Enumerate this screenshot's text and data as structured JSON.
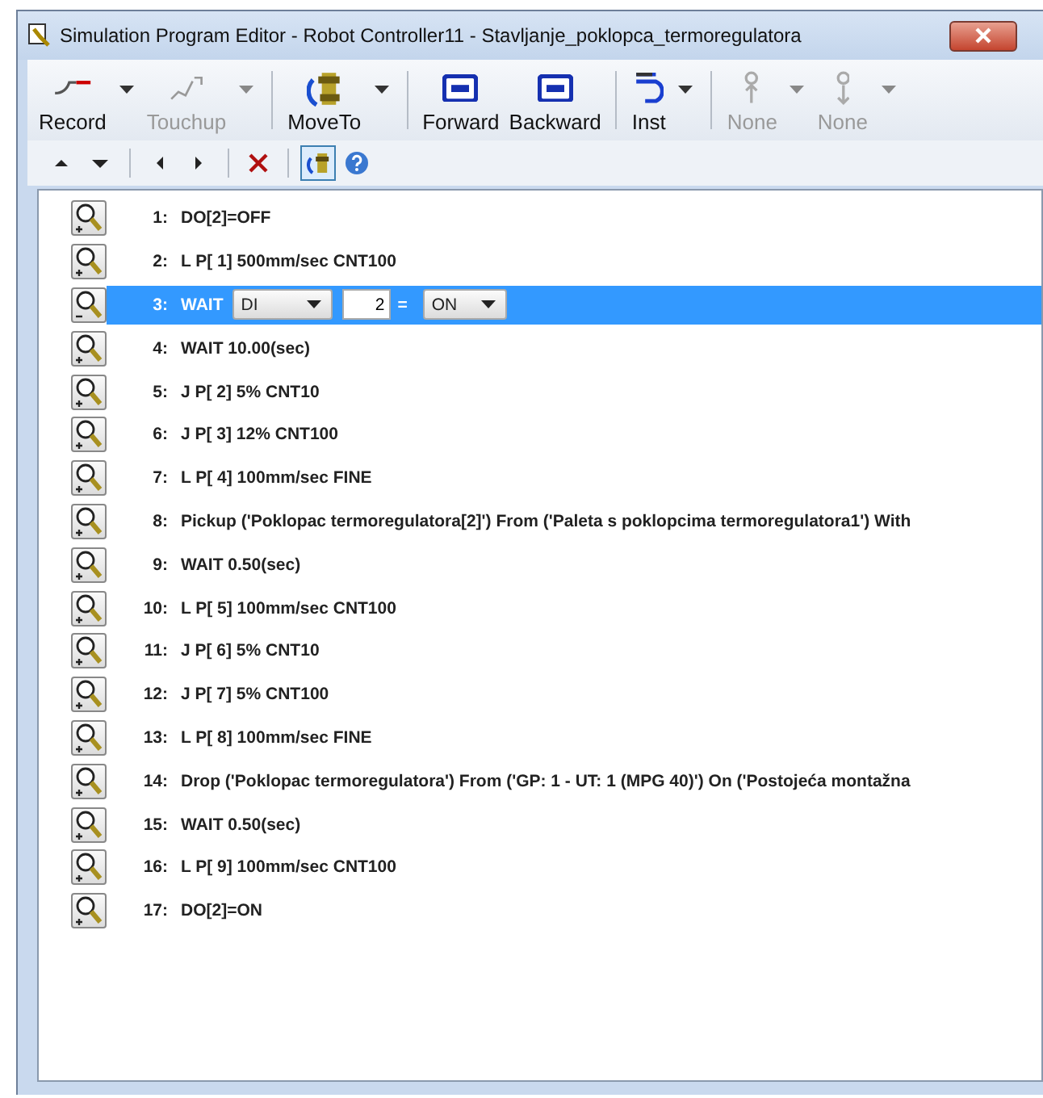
{
  "window": {
    "title": "Simulation Program Editor - Robot Controller11 - Stavljanje_poklopca_termoregulatora"
  },
  "toolbar": [
    {
      "kind": "record",
      "label": "Record",
      "disabled": false,
      "dropdown": true
    },
    {
      "kind": "touchup",
      "label": "Touchup",
      "disabled": true,
      "dropdown": true
    },
    {
      "kind": "moveto",
      "label": "MoveTo",
      "disabled": false,
      "dropdown": true
    },
    {
      "kind": "forward",
      "label": "Forward",
      "disabled": false,
      "dropdown": false
    },
    {
      "kind": "backward",
      "label": "Backward",
      "disabled": false,
      "dropdown": false
    },
    {
      "kind": "inst",
      "label": "Inst",
      "disabled": false,
      "dropdown": true
    },
    {
      "kind": "none-up",
      "label": "None",
      "disabled": true,
      "dropdown": true
    },
    {
      "kind": "none-down",
      "label": "None",
      "disabled": true,
      "dropdown": true
    }
  ],
  "secondary_toolbar": [
    {
      "kind": "up",
      "selected": false
    },
    {
      "kind": "down",
      "selected": false
    },
    {
      "kind": "left",
      "selected": false
    },
    {
      "kind": "right",
      "selected": false
    },
    {
      "kind": "delete",
      "selected": false
    },
    {
      "kind": "robot",
      "selected": true
    },
    {
      "kind": "help",
      "selected": false
    }
  ],
  "program_lines": [
    {
      "number": "1:",
      "text": "DO[2]=OFF",
      "selected": false,
      "expanded": false
    },
    {
      "number": "2:",
      "text": "L P[ 1] 500mm/sec  CNT100",
      "selected": false,
      "expanded": false
    },
    {
      "number": "3:",
      "kind": "edit",
      "keyword": "WAIT",
      "signal": "DI",
      "index": "2",
      "operator": "=",
      "state": "ON",
      "selected": true,
      "expanded": true
    },
    {
      "number": "4:",
      "text": "WAIT 10.00(sec)",
      "selected": false,
      "expanded": false
    },
    {
      "number": "5:",
      "text": "J P[ 2] 5%  CNT10",
      "selected": false,
      "expanded": false
    },
    {
      "number": "6:",
      "text": "J P[ 3] 12%  CNT100",
      "selected": false,
      "expanded": false
    },
    {
      "number": "7:",
      "text": "L P[ 4] 100mm/sec  FINE",
      "selected": false,
      "expanded": false
    },
    {
      "number": "8:",
      "text": "Pickup ('Poklopac termoregulatora[2]') From ('Paleta s poklopcima termoregulatora1') With",
      "selected": false,
      "expanded": false
    },
    {
      "number": "9:",
      "text": "WAIT 0.50(sec)",
      "selected": false,
      "expanded": false
    },
    {
      "number": "10:",
      "text": "L P[ 5] 100mm/sec  CNT100",
      "selected": false,
      "expanded": false
    },
    {
      "number": "11:",
      "text": "J P[ 6] 5%  CNT10",
      "selected": false,
      "expanded": false
    },
    {
      "number": "12:",
      "text": "J P[ 7] 5%  CNT100",
      "selected": false,
      "expanded": false
    },
    {
      "number": "13:",
      "text": "L P[ 8] 100mm/sec  FINE",
      "selected": false,
      "expanded": false
    },
    {
      "number": "14:",
      "text": "Drop ('Poklopac termoregulatora') From ('GP: 1 - UT: 1  (MPG 40)') On ('Postojeća montažna",
      "selected": false,
      "expanded": false
    },
    {
      "number": "15:",
      "text": "WAIT 0.50(sec)",
      "selected": false,
      "expanded": false
    },
    {
      "number": "16:",
      "text": "L P[ 9] 100mm/sec  CNT100",
      "selected": false,
      "expanded": false
    },
    {
      "number": "17:",
      "text": "DO[2]=ON",
      "selected": false,
      "expanded": false
    }
  ]
}
